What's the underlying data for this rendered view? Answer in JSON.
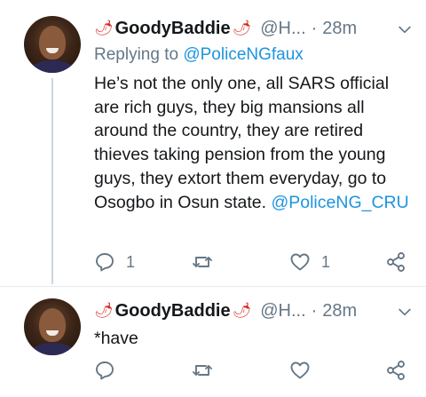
{
  "tweets": [
    {
      "author_name": "GoodyBaddie",
      "author_emoji_left": "🌶",
      "author_emoji_right": "🌶",
      "handle": "@H...",
      "separator": "·",
      "time": "28m",
      "replying_label": "Replying to ",
      "replying_to": "@PoliceNGfaux",
      "text": "He’s not the only one, all SARS official are rich  guys, they big mansions all around the country, they are retired thieves taking pension from the young guys, they extort them everyday, go to Osogbo in Osun state. ",
      "text_mention": "@PoliceNG_CRU",
      "reply_count": "1",
      "retweet_count": "",
      "like_count": "1"
    },
    {
      "author_name": "GoodyBaddie",
      "author_emoji_left": "🌶",
      "author_emoji_right": "🌶",
      "handle": "@H...",
      "separator": "·",
      "time": "28m",
      "text": "*have",
      "reply_count": "",
      "retweet_count": "",
      "like_count": ""
    }
  ],
  "colors": {
    "text": "#14171a",
    "secondary": "#657786",
    "link": "#1b95e0",
    "divider": "#e6ecf0",
    "chili": "#d7261e"
  },
  "icons": [
    "reply-icon",
    "retweet-icon",
    "like-icon",
    "share-icon",
    "chevron-down-icon",
    "chili-pepper-icon"
  ]
}
